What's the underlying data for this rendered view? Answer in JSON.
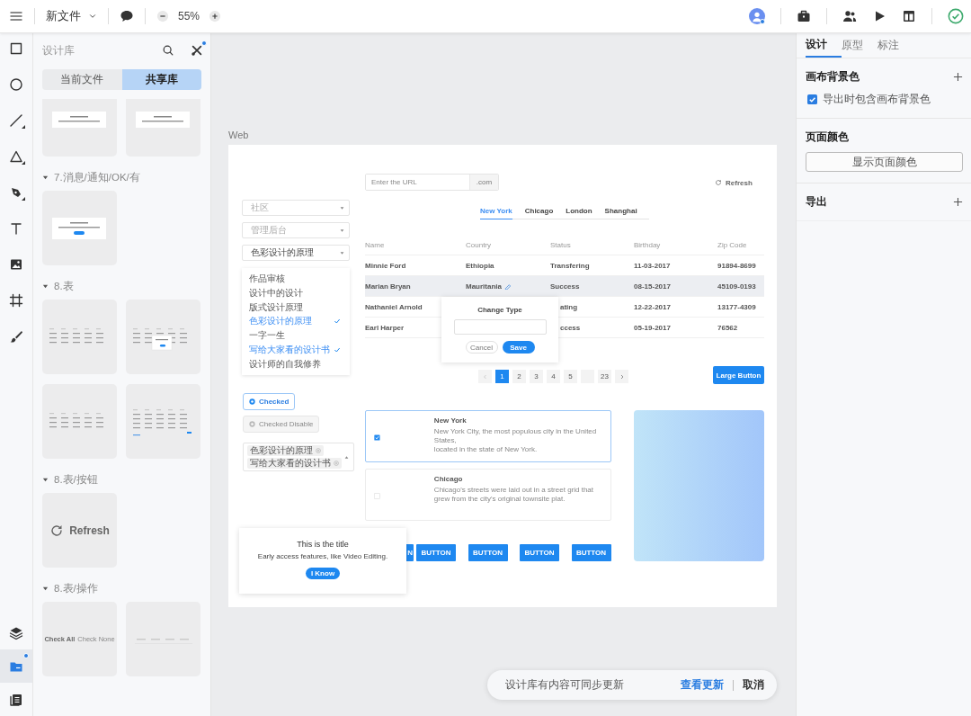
{
  "topbar": {
    "file_name": "新文件",
    "zoom": "55%",
    "avatar_badge": true
  },
  "tools": [
    {
      "kind": "rectangle",
      "selected": false
    },
    {
      "kind": "ellipse",
      "selected": false
    },
    {
      "kind": "line",
      "selected": false
    },
    {
      "kind": "triangle",
      "selected": false
    },
    {
      "kind": "pen",
      "selected": false
    },
    {
      "kind": "text",
      "selected": false
    },
    {
      "kind": "image",
      "selected": false
    },
    {
      "kind": "frame",
      "selected": false
    },
    {
      "kind": "brush",
      "selected": false
    }
  ],
  "bottom_tools": [
    {
      "kind": "layers",
      "selected": false,
      "badge": false
    },
    {
      "kind": "library",
      "selected": true,
      "badge": true
    },
    {
      "kind": "book",
      "selected": false,
      "badge": false
    }
  ],
  "library": {
    "title": "设计库",
    "plugin_badge": true,
    "tabs": [
      {
        "label": "当前文件",
        "selected": false
      },
      {
        "label": "共享库",
        "selected": true
      }
    ],
    "sections": [
      {
        "cut": true,
        "thumbs": [
          {
            "kind": "dialog"
          },
          {
            "kind": "dialog"
          }
        ]
      },
      {
        "title": "7.消息/通知/OK/有",
        "thumbs": [
          {
            "kind": "dialog-button"
          }
        ]
      },
      {
        "title": "8.表",
        "thumbs": [
          {
            "kind": "table"
          },
          {
            "kind": "table-popover"
          },
          {
            "kind": "table"
          },
          {
            "kind": "table-pager"
          }
        ]
      },
      {
        "title": "8.表/按钮",
        "thumbs": [
          {
            "kind": "refresh",
            "label": "Refresh"
          }
        ]
      },
      {
        "title": "8.表/操作",
        "thumbs": [
          {
            "kind": "actions",
            "labels": [
              "Check All",
              "Check None"
            ]
          },
          {
            "kind": "lines"
          }
        ]
      }
    ]
  },
  "canvas": {
    "artboard": "Web",
    "selects": [
      {
        "placeholder": "社区"
      },
      {
        "placeholder": "管理后台"
      },
      {
        "value": "色彩设计的原理"
      }
    ],
    "menu": [
      {
        "label": "作品审核",
        "selected": false
      },
      {
        "label": "设计中的设计",
        "selected": false
      },
      {
        "label": "版式设计原理",
        "selected": false
      },
      {
        "label": "色彩设计的原理",
        "selected": true
      },
      {
        "label": "一字一生",
        "selected": false
      },
      {
        "label": "写给大家看的设计书",
        "selected": true
      },
      {
        "label": "设计师的自我修养",
        "selected": false
      }
    ],
    "radios": [
      {
        "label": "Checked",
        "checked": true,
        "disabled": false
      },
      {
        "label": "Checked Disable",
        "checked": true,
        "disabled": true
      }
    ],
    "tags": [
      "色彩设计的原理",
      "写给大家看的设计书"
    ],
    "notification": {
      "title": "This is the title",
      "text": "Early access features, like Video Editing.",
      "button": "I Know"
    },
    "url": {
      "placeholder": "Enter the URL",
      "suffix": ".com"
    },
    "refresh": "Refresh",
    "tabs": [
      {
        "label": "New York",
        "selected": true
      },
      {
        "label": "Chicago",
        "selected": false
      },
      {
        "label": "London",
        "selected": false
      },
      {
        "label": "Shanghai",
        "selected": false
      }
    ],
    "table": {
      "columns": [
        "Name",
        "Country",
        "Status",
        "Birthday",
        "Zip Code"
      ],
      "rows": [
        {
          "name": "Minnie Ford",
          "country": "Ethiopia",
          "status": "Transfering",
          "birthday": "11-03-2017",
          "zip": "91894-8699",
          "highlighted": false,
          "editing": false,
          "covered": false
        },
        {
          "name": "Marian Bryan",
          "country": "Mauritania",
          "status": "Success",
          "birthday": "08-15-2017",
          "zip": "45109-0193",
          "highlighted": true,
          "editing": true,
          "covered": false
        },
        {
          "name": "Nathaniel Arnold",
          "status": "ating",
          "birthday": "12-22-2017",
          "zip": "13177-4309",
          "highlighted": false,
          "editing": false,
          "covered": true
        },
        {
          "name": "Earl Harper",
          "status": "ccess",
          "birthday": "05-19-2017",
          "zip": "76562",
          "highlighted": false,
          "editing": false,
          "covered": true
        }
      ]
    },
    "popover": {
      "title": "Change Type",
      "buttons": [
        {
          "label": "Cancel",
          "kind": "secondary"
        },
        {
          "label": "Save",
          "kind": "primary"
        }
      ]
    },
    "pages": [
      {
        "label": "1",
        "selected": true
      },
      {
        "label": "2",
        "selected": false
      },
      {
        "label": "3",
        "selected": false
      },
      {
        "label": "4",
        "selected": false
      },
      {
        "label": "5",
        "selected": false
      },
      {
        "selected": false
      },
      {
        "label": "23",
        "selected": false
      }
    ],
    "large_button": "Large Button",
    "cards": [
      {
        "title": "New York",
        "text": "New York City, the most populous city in the United States,\nlocated in the state of New York.",
        "checked": true
      },
      {
        "title": "Chicago",
        "text": "Chicago's streets were laid out in a street grid that grew from the city's original townsite plat.",
        "checked": false
      }
    ],
    "buttons": [
      "N",
      "BUTTON",
      "BUTTON",
      "BUTTON",
      "BUTTON"
    ]
  },
  "inspector": {
    "tabs": [
      {
        "label": "设计",
        "selected": true
      },
      {
        "label": "原型",
        "selected": false
      },
      {
        "label": "标注",
        "selected": false
      }
    ],
    "sections": [
      {
        "title": "画布背景色",
        "add": true,
        "checkbox": {
          "label": "导出时包含画布背景色",
          "checked": true
        }
      },
      {
        "title": "页面颜色",
        "add": false,
        "button": "显示页面颜色"
      },
      {
        "title": "导出",
        "add": true
      }
    ]
  },
  "toast": {
    "message": "设计库有内容可同步更新",
    "actions": [
      {
        "label": "查看更新",
        "kind": "primary"
      },
      {
        "label": "取消",
        "kind": "plain"
      }
    ]
  }
}
